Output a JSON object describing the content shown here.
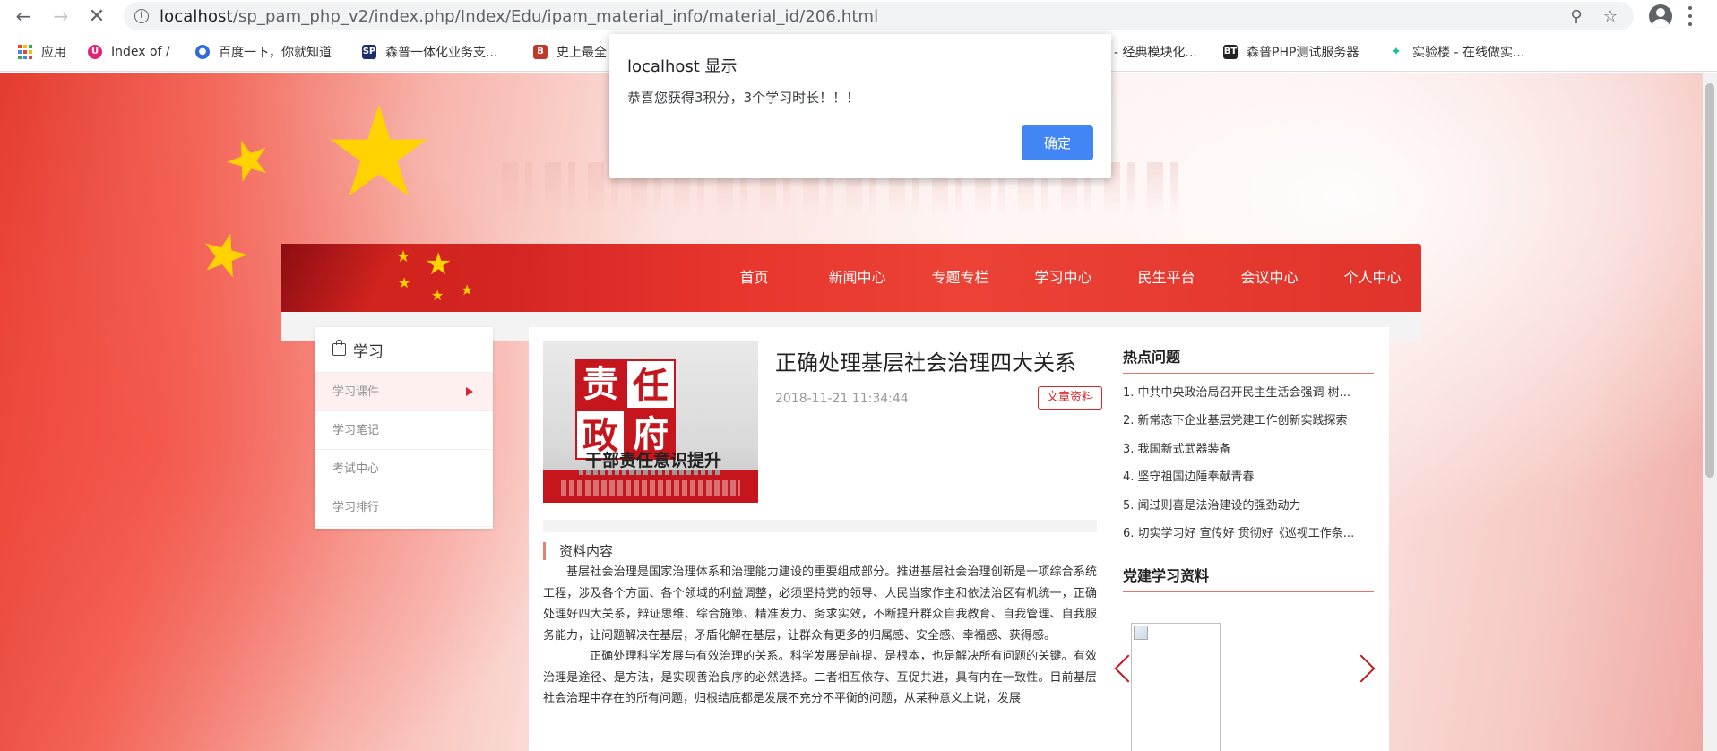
{
  "browser": {
    "url_host": "localhost",
    "url_path": "/sp_pam_php_v2/index.php/Index/Edu/ipam_material_info/material_id/206.html",
    "bookmarks": [
      {
        "label": "应用",
        "icon": "apps-icon"
      },
      {
        "label": "Index of /",
        "icon": "index-favicon"
      },
      {
        "label": "百度一下，你就知道",
        "icon": "baidu-favicon"
      },
      {
        "label": "森普一体化业务支...",
        "icon": "sp-favicon"
      },
      {
        "label": "史上最全",
        "icon": "b-favicon"
      },
      {
        "label": "- 经典模块化...",
        "icon": "none"
      },
      {
        "label": "森普PHP测试服务器",
        "icon": "bt-favicon"
      },
      {
        "label": "实验楼 - 在线做实...",
        "icon": "shiyanlou-favicon"
      }
    ]
  },
  "nav": {
    "items": [
      "首页",
      "新闻中心",
      "专题专栏",
      "学习中心",
      "民生平台",
      "会议中心",
      "个人中心"
    ]
  },
  "left_menu": {
    "title": "学习",
    "items": [
      {
        "label": "学习课件",
        "active": true
      },
      {
        "label": "学习笔记",
        "active": false
      },
      {
        "label": "考试中心",
        "active": false
      },
      {
        "label": "学习排行",
        "active": false
      }
    ]
  },
  "article": {
    "cover": {
      "chars": [
        "责",
        "任",
        "政",
        "府"
      ],
      "subtitle": "干部责任意识提升"
    },
    "title": "正确处理基层社会治理四大关系",
    "date": "2018-11-21 11:34:44",
    "tag": "文章资料",
    "section_title": "资料内容",
    "paragraphs": [
      "基层社会治理是国家治理体系和治理能力建设的重要组成部分。推进基层社会治理创新是一项综合系统工程，涉及各个方面、各个领域的利益调整，必须坚持党的领导、人民当家作主和依法治区有机统一，正确处理好四大关系，辩证思维、综合施策、精准发力、务求实效，不断提升群众自我教育、自我管理、自我服务能力，让问题解决在基层，矛盾化解在基层，让群众有更多的归属感、安全感、幸福感、获得感。",
      "正确处理科学发展与有效治理的关系。科学发展是前提、是根本，也是解决所有问题的关键。有效治理是途径、是方法，是实现善治良序的必然选择。二者相互依存、互促共进，具有内在一致性。目前基层社会治理中存在的所有问题，归根结底都是发展不充分不平衡的问题，从某种意义上说，发展"
    ]
  },
  "sidebar": {
    "hot_title": "热点问题",
    "hot_items": [
      "1. 中共中央政治局召开民主生活会强调 树...",
      "2. 新常态下企业基层党建工作创新实践探索",
      "3. 我国新式武器装备",
      "4. 坚守祖国边陲奉献青春",
      "5. 闻过则喜是法治建设的强劲动力",
      "6. 切实学习好 宣传好 贯彻好《巡视工作条..."
    ],
    "materials_title": "党建学习资料"
  },
  "dialog": {
    "title": "localhost 显示",
    "message": "恭喜您获得3积分，3个学习时长！！！",
    "ok_label": "确定"
  },
  "colors": {
    "primary_red": "#d6262b",
    "dialog_button": "#4285f4",
    "star_gold": "#ffd200"
  }
}
